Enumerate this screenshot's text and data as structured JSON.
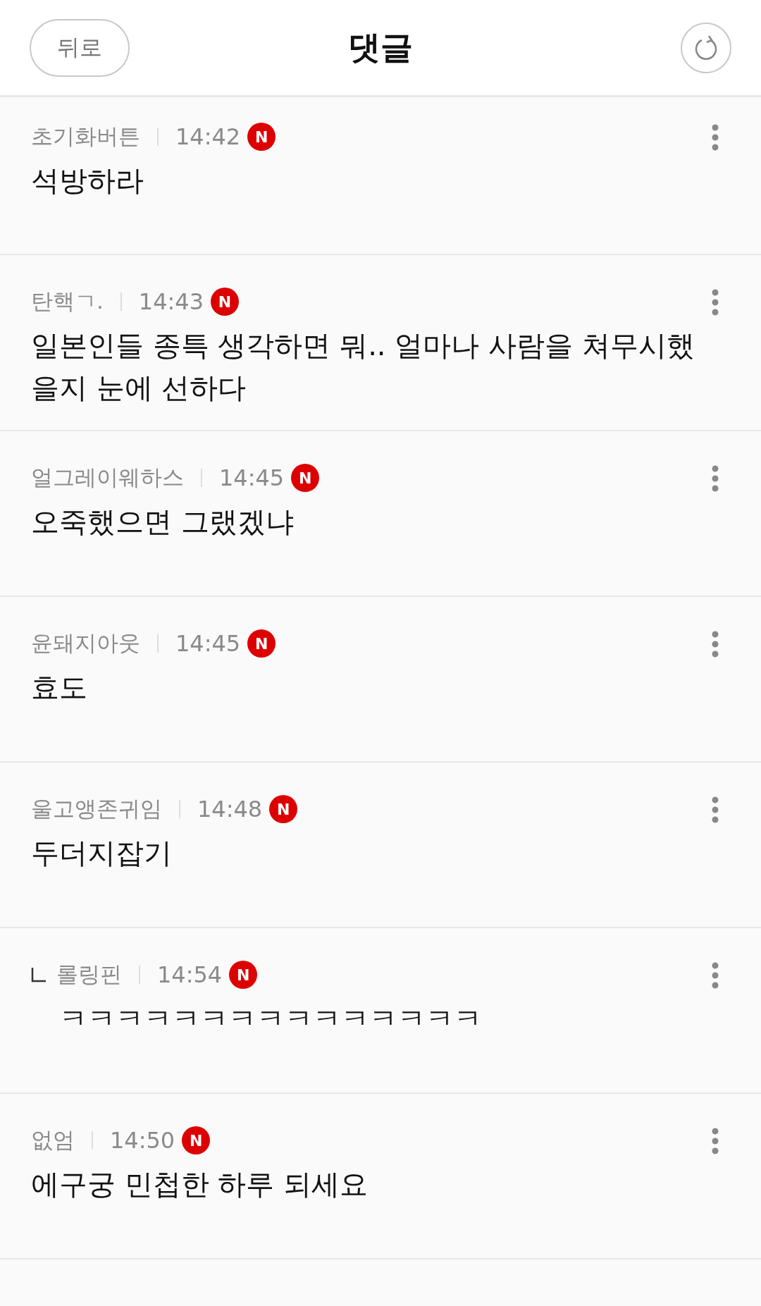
{
  "header": {
    "back_button": "뒤로",
    "title": "댓글"
  },
  "comments": [
    {
      "kind": "comment",
      "author": "초기화버튼",
      "time": "14:42",
      "badge": "N",
      "text": "석방하라"
    },
    {
      "kind": "comment",
      "author": "탄핵ㄱ.",
      "time": "14:43",
      "badge": "N",
      "text": "일본인들 종특 생각하면 뭐.. 얼마나 사람을 쳐무시했을지 눈에 선하다"
    },
    {
      "kind": "comment",
      "author": "얼그레이웨하스",
      "time": "14:45",
      "badge": "N",
      "text": "오죽했으면 그랬겠냐"
    },
    {
      "kind": "comment",
      "author": "윤돼지아웃",
      "time": "14:45",
      "badge": "N",
      "text": "효도"
    },
    {
      "kind": "comment",
      "author": "울고앵존귀임",
      "time": "14:48",
      "badge": "N",
      "text": "두더지잡기"
    },
    {
      "kind": "reply",
      "author": "롤링핀",
      "time": "14:54",
      "badge": "N",
      "text": "ㅋㅋㅋㅋㅋㅋㅋㅋㅋㅋㅋㅋㅋㅋㅋ"
    },
    {
      "kind": "comment",
      "author": "없엄",
      "time": "14:50",
      "badge": "N",
      "text": "에구궁 민첩한 하루 되세요"
    }
  ]
}
